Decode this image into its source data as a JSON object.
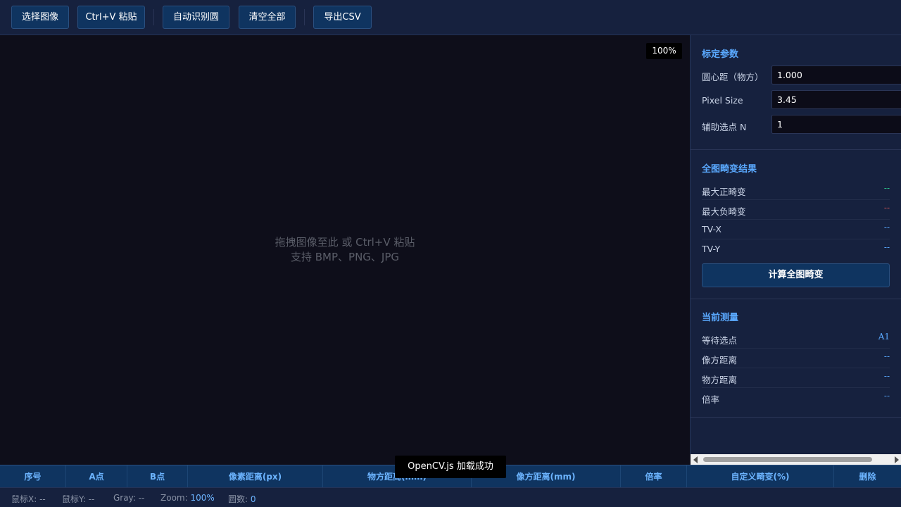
{
  "toolbar": {
    "select_image": "选择图像",
    "paste": "Ctrl+V 粘贴",
    "auto_detect": "自动识别圆",
    "clear_all": "清空全部",
    "export_csv": "导出CSV"
  },
  "canvas": {
    "zoom_badge": "100%",
    "hint_line1": "拖拽图像至此 或 Ctrl+V 粘贴",
    "hint_line2": "支持 BMP、PNG、JPG"
  },
  "calibration": {
    "title": "标定参数",
    "fields": [
      {
        "label": "圆心距（物方）",
        "value": "1.000"
      },
      {
        "label": "Pixel Size",
        "value": "3.45"
      },
      {
        "label": "辅助选点 N",
        "value": "1"
      }
    ]
  },
  "distortion": {
    "title": "全图畸变结果",
    "rows": [
      {
        "label": "最大正畸变",
        "value": "--"
      },
      {
        "label": "最大负畸变",
        "value": "--"
      },
      {
        "label": "TV-X",
        "value": "--"
      },
      {
        "label": "TV-Y",
        "value": "--"
      }
    ],
    "compute_button": "计算全图畸变"
  },
  "measurement": {
    "title": "当前测量",
    "rows": [
      {
        "label": "等待选点",
        "value": "A1"
      },
      {
        "label": "像方距离",
        "value": "--"
      },
      {
        "label": "物方距离",
        "value": "--"
      },
      {
        "label": "倍率",
        "value": "--"
      }
    ]
  },
  "table": {
    "headers": [
      "序号",
      "A点",
      "B点",
      "像素距离(px)",
      "物方距离(mm)",
      "像方距离(mm)",
      "倍率",
      "自定义畸变(%)",
      "删除"
    ]
  },
  "toast": "OpenCV.js 加载成功",
  "status": {
    "mouse_x_label": "鼠标X:",
    "mouse_x": "--",
    "mouse_y_label": "鼠标Y:",
    "mouse_y": "--",
    "gray_label": "Gray:",
    "gray": "--",
    "zoom_label": "Zoom:",
    "zoom": "100%",
    "circles_label": "圆数:",
    "circles": "0"
  },
  "colors": {
    "background": "#0e0e1a",
    "panel": "#16213e",
    "button": "#0f3460",
    "accent": "#5aa9ff",
    "positive": "#2ecc8f",
    "negative": "#e05a5a"
  }
}
